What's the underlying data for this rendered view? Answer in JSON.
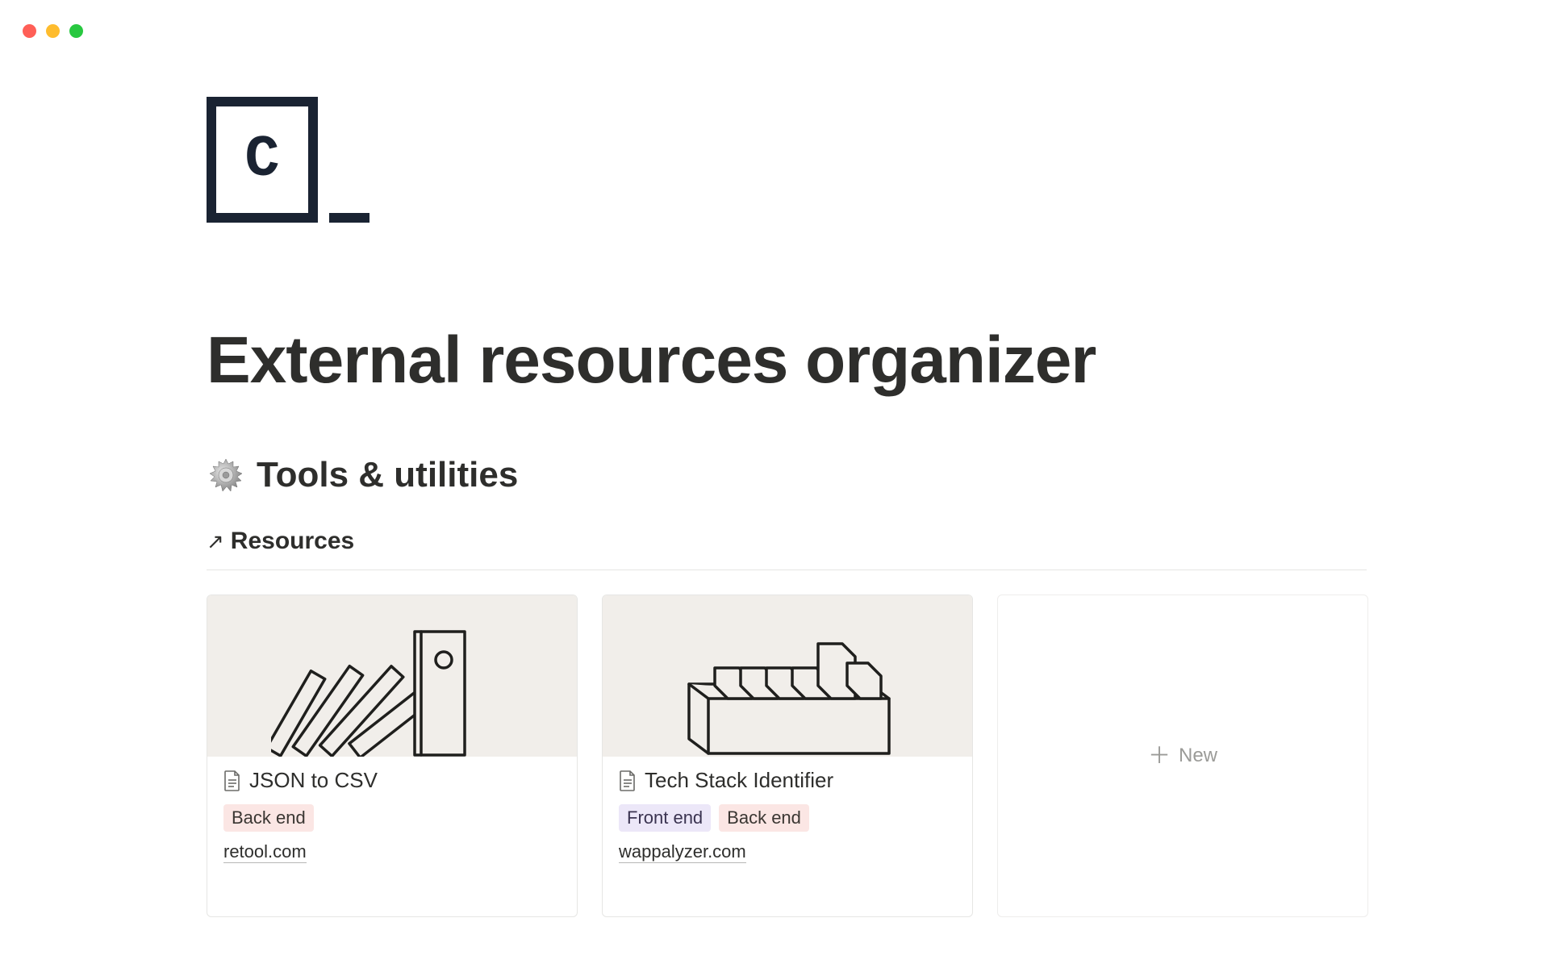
{
  "page": {
    "title": "External resources organizer"
  },
  "section": {
    "icon": "gear",
    "title": "Tools & utilities",
    "database_title": "Resources"
  },
  "cards": {
    "card0": {
      "title": "JSON to CSV",
      "tags": {
        "t0": "Back end"
      },
      "url": "retool.com"
    },
    "card1": {
      "title": "Tech Stack Identifier",
      "tags": {
        "t0": "Front end",
        "t1": "Back end"
      },
      "url": "wappalyzer.com"
    }
  },
  "new_card_label": "New"
}
